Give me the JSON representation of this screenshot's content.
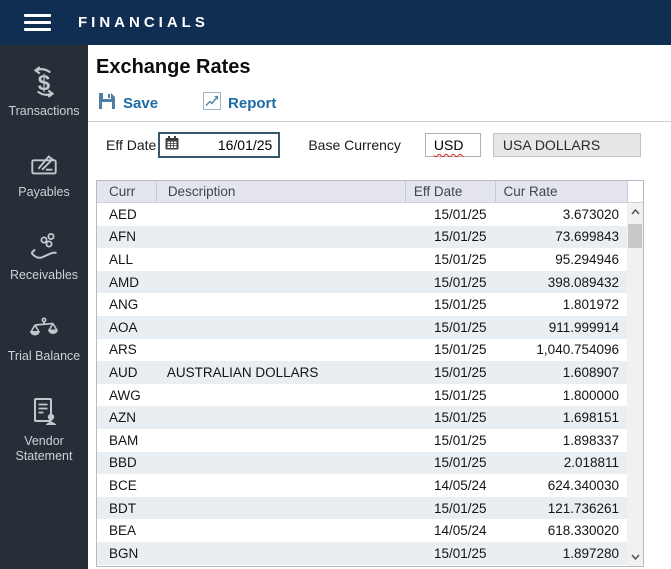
{
  "app": {
    "brand": "FINANCIALS"
  },
  "sidebar": {
    "items": [
      {
        "label": "Transactions",
        "icon": "currency-exchange-icon"
      },
      {
        "label": "Payables",
        "icon": "cheque-pen-icon"
      },
      {
        "label": "Receivables",
        "icon": "hand-coins-icon"
      },
      {
        "label": "Trial Balance",
        "icon": "scales-icon"
      },
      {
        "label": "Vendor Statement",
        "icon": "document-person-icon"
      }
    ]
  },
  "page": {
    "title": "Exchange Rates"
  },
  "toolbar": {
    "save_label": "Save",
    "report_label": "Report"
  },
  "form": {
    "eff_date_label": "Eff Date",
    "eff_date_value": "16/01/25",
    "base_currency_label": "Base Currency",
    "base_currency_code": "USD",
    "base_currency_name": "USA DOLLARS"
  },
  "table": {
    "columns": [
      "Curr",
      "Description",
      "Eff Date",
      "Cur Rate"
    ],
    "rows": [
      [
        "AED",
        "",
        "15/01/25",
        "3.673020"
      ],
      [
        "AFN",
        "",
        "15/01/25",
        "73.699843"
      ],
      [
        "ALL",
        "",
        "15/01/25",
        "95.294946"
      ],
      [
        "AMD",
        "",
        "15/01/25",
        "398.089432"
      ],
      [
        "ANG",
        "",
        "15/01/25",
        "1.801972"
      ],
      [
        "AOA",
        "",
        "15/01/25",
        "911.999914"
      ],
      [
        "ARS",
        "",
        "15/01/25",
        "1,040.754096"
      ],
      [
        "AUD",
        "AUSTRALIAN DOLLARS",
        "15/01/25",
        "1.608907"
      ],
      [
        "AWG",
        "",
        "15/01/25",
        "1.800000"
      ],
      [
        "AZN",
        "",
        "15/01/25",
        "1.698151"
      ],
      [
        "BAM",
        "",
        "15/01/25",
        "1.898337"
      ],
      [
        "BBD",
        "",
        "15/01/25",
        "2.018811"
      ],
      [
        "BCE",
        "",
        "14/05/24",
        "624.340030"
      ],
      [
        "BDT",
        "",
        "15/01/25",
        "121.736261"
      ],
      [
        "BEA",
        "",
        "14/05/24",
        "618.330020"
      ],
      [
        "BGN",
        "",
        "15/01/25",
        "1.897280"
      ]
    ]
  },
  "colors": {
    "topbar": "#102e51",
    "sidebar": "#272e37",
    "accent_blue": "#1d6ba5",
    "table_header_bg": "#e4e4ee",
    "row_alt_bg": "#e9eef2",
    "spellcheck_red": "#e02b20"
  }
}
